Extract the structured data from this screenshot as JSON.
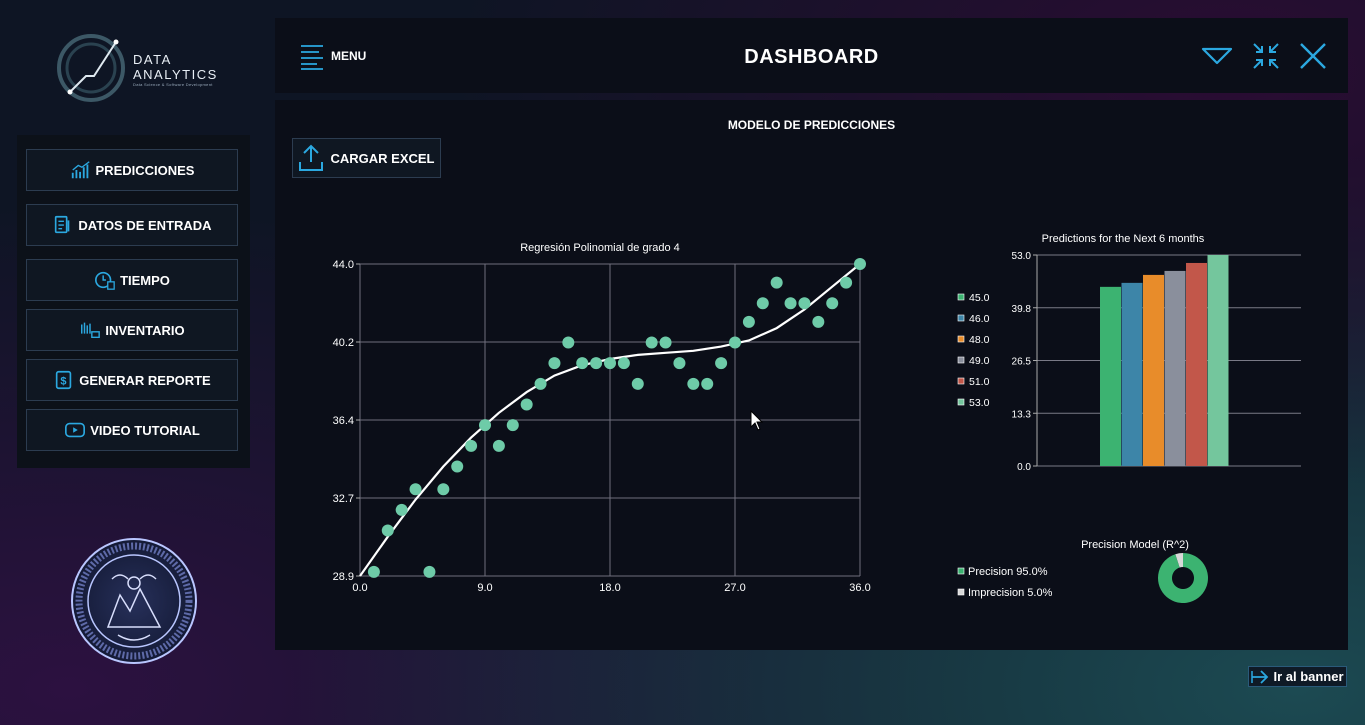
{
  "app": {
    "logo_line1": "DATA",
    "logo_line2": "ANALYTICS",
    "logo_sub": "Data Science & Software Development",
    "title": "DASHBOARD",
    "menu_label": "MENU"
  },
  "sidebar": {
    "items": [
      {
        "label": "PREDICCIONES",
        "icon": "chart-icon"
      },
      {
        "label": "DATOS DE ENTRADA",
        "icon": "data-icon"
      },
      {
        "label": "TIEMPO",
        "icon": "clock-icon"
      },
      {
        "label": "INVENTARIO",
        "icon": "inventory-icon"
      },
      {
        "label": "GENERAR REPORTE",
        "icon": "report-icon"
      },
      {
        "label": "VIDEO TUTORIAL",
        "icon": "video-icon"
      }
    ]
  },
  "main": {
    "title": "MODELO DE PREDICCIONES",
    "upload_label": "CARGAR EXCEL"
  },
  "footer": {
    "banner_label": "Ir al banner"
  },
  "colors": {
    "accent": "#2ba8e0",
    "point": "#6ecba8",
    "panel": "#0b0e18"
  },
  "chart_data": [
    {
      "type": "scatter",
      "title": "Regresión Polinomial de grado 4",
      "xlabel": "",
      "ylabel": "",
      "xlim": [
        0,
        36
      ],
      "ylim": [
        28.9,
        44.0
      ],
      "x_ticks": [
        "0.0",
        "9.0",
        "18.0",
        "27.0",
        "36.0"
      ],
      "y_ticks": [
        "28.9",
        "32.7",
        "36.4",
        "40.2",
        "44.0"
      ],
      "grid": true,
      "points": [
        [
          1,
          29.1
        ],
        [
          2,
          31.1
        ],
        [
          3,
          32.1
        ],
        [
          4,
          33.1
        ],
        [
          5,
          29.1
        ],
        [
          6,
          33.1
        ],
        [
          7,
          34.2
        ],
        [
          8,
          35.2
        ],
        [
          9,
          36.2
        ],
        [
          10,
          35.2
        ],
        [
          11,
          36.2
        ],
        [
          12,
          37.2
        ],
        [
          13,
          38.2
        ],
        [
          14,
          39.2
        ],
        [
          15,
          40.2
        ],
        [
          16,
          39.2
        ],
        [
          17,
          39.2
        ],
        [
          18,
          39.2
        ],
        [
          19,
          39.2
        ],
        [
          20,
          38.2
        ],
        [
          21,
          40.2
        ],
        [
          22,
          40.2
        ],
        [
          23,
          39.2
        ],
        [
          24,
          38.2
        ],
        [
          25,
          38.2
        ],
        [
          26,
          39.2
        ],
        [
          27,
          40.2
        ],
        [
          28,
          41.2
        ],
        [
          29,
          42.1
        ],
        [
          30,
          43.1
        ],
        [
          31,
          42.1
        ],
        [
          32,
          42.1
        ],
        [
          33,
          41.2
        ],
        [
          34,
          42.1
        ],
        [
          35,
          43.1
        ],
        [
          36,
          44.0
        ]
      ],
      "curve": [
        [
          0,
          28.9
        ],
        [
          2,
          30.8
        ],
        [
          4,
          32.6
        ],
        [
          6,
          34.2
        ],
        [
          8,
          35.6
        ],
        [
          10,
          36.8
        ],
        [
          12,
          37.8
        ],
        [
          14,
          38.6
        ],
        [
          16,
          39.1
        ],
        [
          18,
          39.4
        ],
        [
          20,
          39.6
        ],
        [
          22,
          39.7
        ],
        [
          24,
          39.8
        ],
        [
          26,
          40.0
        ],
        [
          28,
          40.3
        ],
        [
          30,
          40.9
        ],
        [
          32,
          41.8
        ],
        [
          34,
          42.9
        ],
        [
          36,
          44.0
        ]
      ]
    },
    {
      "type": "bar",
      "title": "Predictions for the Next 6 months",
      "categories": [
        "45.0",
        "46.0",
        "48.0",
        "49.0",
        "51.0",
        "53.0"
      ],
      "values": [
        45.0,
        46.0,
        48.0,
        49.0,
        51.0,
        53.0
      ],
      "ylim": [
        0,
        53.0
      ],
      "y_ticks": [
        "0.0",
        "13.3",
        "26.5",
        "39.8",
        "53.0"
      ],
      "legend": "left",
      "colors": [
        "#3cb371",
        "#3d85a8",
        "#e88c2a",
        "#8a8f9c",
        "#c2574a",
        "#74c69d"
      ]
    },
    {
      "type": "pie",
      "title": "Precision Model (R^2)",
      "slices": [
        {
          "label": "Precision 95.0%",
          "value": 95.0,
          "color": "#3cb371"
        },
        {
          "label": "Imprecision 5.0%",
          "value": 5.0,
          "color": "#d8d8d8"
        }
      ],
      "legend": "left"
    }
  ]
}
